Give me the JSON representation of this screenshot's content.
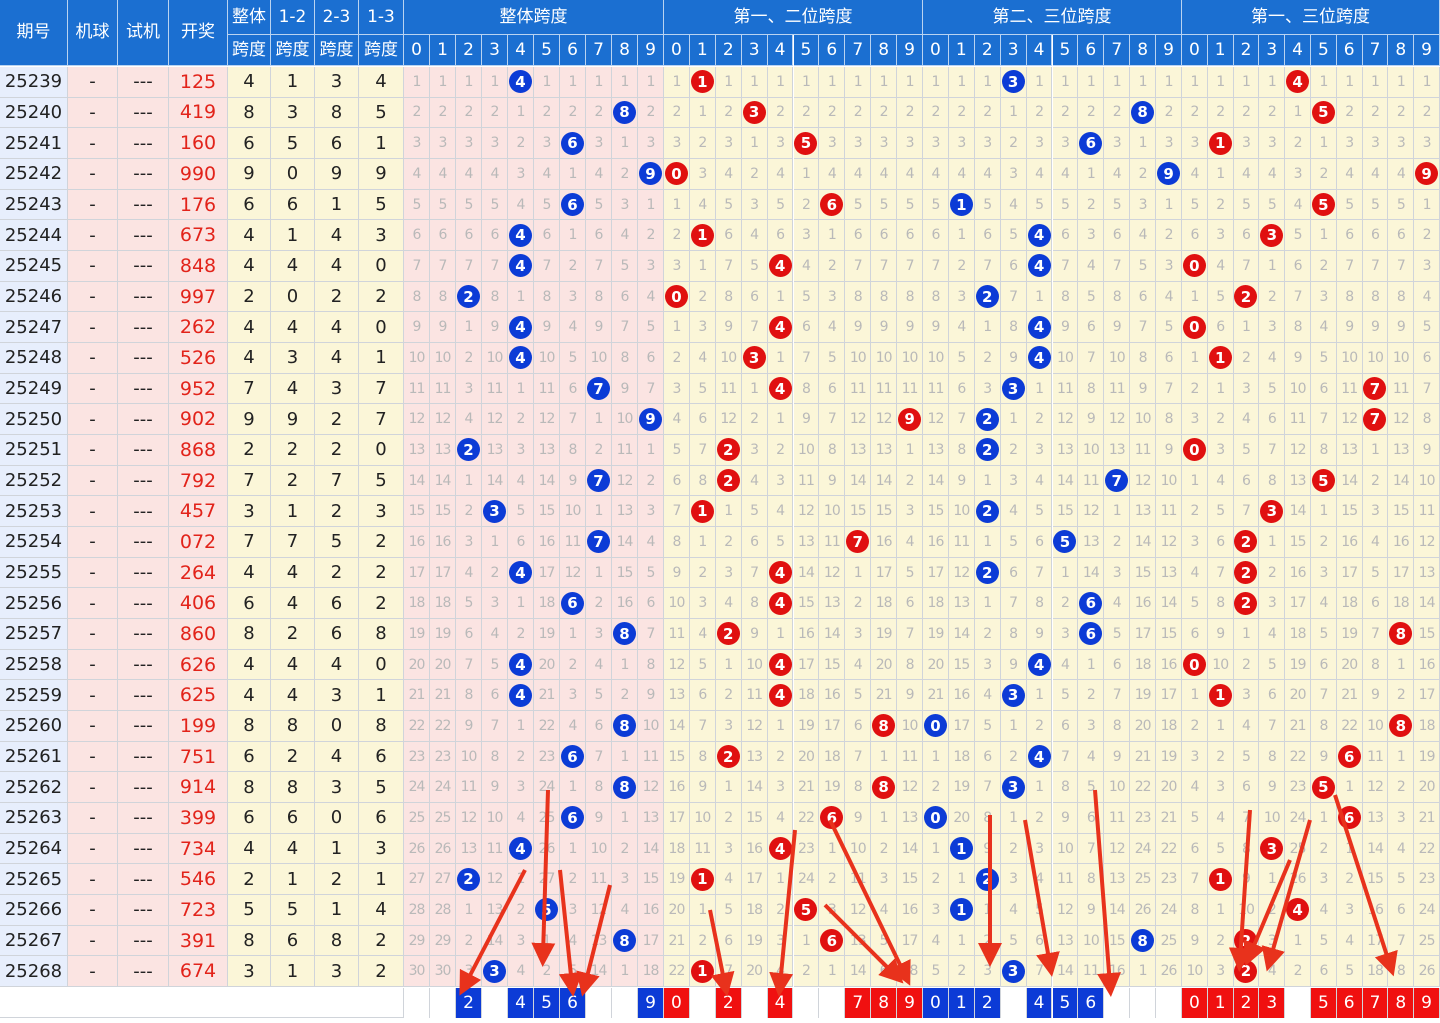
{
  "header": {
    "issue": "期号",
    "machine": "机球",
    "test": "试机",
    "draw": "开奖",
    "span_all": [
      "整体",
      "跨度"
    ],
    "span_12": [
      "1-2",
      "跨度"
    ],
    "span_23": [
      "2-3",
      "跨度"
    ],
    "span_13": [
      "1-3",
      "跨度"
    ],
    "groups": [
      "整体跨度",
      "第一、二位跨度",
      "第二、三位跨度",
      "第一、三位跨度"
    ],
    "digits": [
      "0",
      "1",
      "2",
      "3",
      "4",
      "5",
      "6",
      "7",
      "8",
      "9"
    ]
  },
  "placeholders": {
    "machine": "-",
    "test": "---"
  },
  "colors": {
    "header_bg": "#1b6fd1",
    "blue_ball": "#0c3bd6",
    "red_ball": "#e01010",
    "draw_text": "#e2231a",
    "arrow": "#e8321c"
  },
  "chart_data": {
    "type": "table",
    "columns": [
      "期号",
      "机球",
      "试机",
      "开奖",
      "整体跨度",
      "1-2跨度",
      "2-3跨度",
      "1-3跨度"
    ],
    "rows": [
      {
        "issue": "25239",
        "draw": "125",
        "span": [
          4,
          1,
          3,
          4
        ]
      },
      {
        "issue": "25240",
        "draw": "419",
        "span": [
          8,
          3,
          8,
          5
        ]
      },
      {
        "issue": "25241",
        "draw": "160",
        "span": [
          6,
          5,
          6,
          1
        ]
      },
      {
        "issue": "25242",
        "draw": "990",
        "span": [
          9,
          0,
          9,
          9
        ]
      },
      {
        "issue": "25243",
        "draw": "176",
        "span": [
          6,
          6,
          1,
          5
        ]
      },
      {
        "issue": "25244",
        "draw": "673",
        "span": [
          4,
          1,
          4,
          3
        ]
      },
      {
        "issue": "25245",
        "draw": "848",
        "span": [
          4,
          4,
          4,
          0
        ]
      },
      {
        "issue": "25246",
        "draw": "997",
        "span": [
          2,
          0,
          2,
          2
        ]
      },
      {
        "issue": "25247",
        "draw": "262",
        "span": [
          4,
          4,
          4,
          0
        ]
      },
      {
        "issue": "25248",
        "draw": "526",
        "span": [
          4,
          3,
          4,
          1
        ]
      },
      {
        "issue": "25249",
        "draw": "952",
        "span": [
          7,
          4,
          3,
          7
        ]
      },
      {
        "issue": "25250",
        "draw": "902",
        "span": [
          9,
          9,
          2,
          7
        ]
      },
      {
        "issue": "25251",
        "draw": "868",
        "span": [
          2,
          2,
          2,
          0
        ]
      },
      {
        "issue": "25252",
        "draw": "792",
        "span": [
          7,
          2,
          7,
          5
        ]
      },
      {
        "issue": "25253",
        "draw": "457",
        "span": [
          3,
          1,
          2,
          3
        ]
      },
      {
        "issue": "25254",
        "draw": "072",
        "span": [
          7,
          7,
          5,
          2
        ]
      },
      {
        "issue": "25255",
        "draw": "264",
        "span": [
          4,
          4,
          2,
          2
        ]
      },
      {
        "issue": "25256",
        "draw": "406",
        "span": [
          6,
          4,
          6,
          2
        ]
      },
      {
        "issue": "25257",
        "draw": "860",
        "span": [
          8,
          2,
          6,
          8
        ]
      },
      {
        "issue": "25258",
        "draw": "626",
        "span": [
          4,
          4,
          4,
          0
        ]
      },
      {
        "issue": "25259",
        "draw": "625",
        "span": [
          4,
          4,
          3,
          1
        ]
      },
      {
        "issue": "25260",
        "draw": "199",
        "span": [
          8,
          8,
          0,
          8
        ]
      },
      {
        "issue": "25261",
        "draw": "751",
        "span": [
          6,
          2,
          4,
          6
        ]
      },
      {
        "issue": "25262",
        "draw": "914",
        "span": [
          8,
          8,
          3,
          5
        ]
      },
      {
        "issue": "25263",
        "draw": "399",
        "span": [
          6,
          6,
          0,
          6
        ]
      },
      {
        "issue": "25264",
        "draw": "734",
        "span": [
          4,
          4,
          1,
          3
        ]
      },
      {
        "issue": "25265",
        "draw": "546",
        "span": [
          2,
          1,
          2,
          1
        ]
      },
      {
        "issue": "25266",
        "draw": "723",
        "span": [
          5,
          5,
          1,
          4
        ]
      },
      {
        "issue": "25267",
        "draw": "391",
        "span": [
          8,
          6,
          8,
          2
        ]
      },
      {
        "issue": "25268",
        "draw": "674",
        "span": [
          3,
          1,
          3,
          2
        ]
      }
    ],
    "bottom_picks": [
      [
        "2",
        "4",
        "5",
        "6",
        "9"
      ],
      [
        "0",
        "2",
        "4",
        "7",
        "8",
        "9"
      ],
      [
        "0",
        "1",
        "2",
        "4",
        "5",
        "6"
      ],
      [
        "0",
        "1",
        "2",
        "3",
        "5",
        "6",
        "7",
        "8",
        "9"
      ]
    ]
  }
}
